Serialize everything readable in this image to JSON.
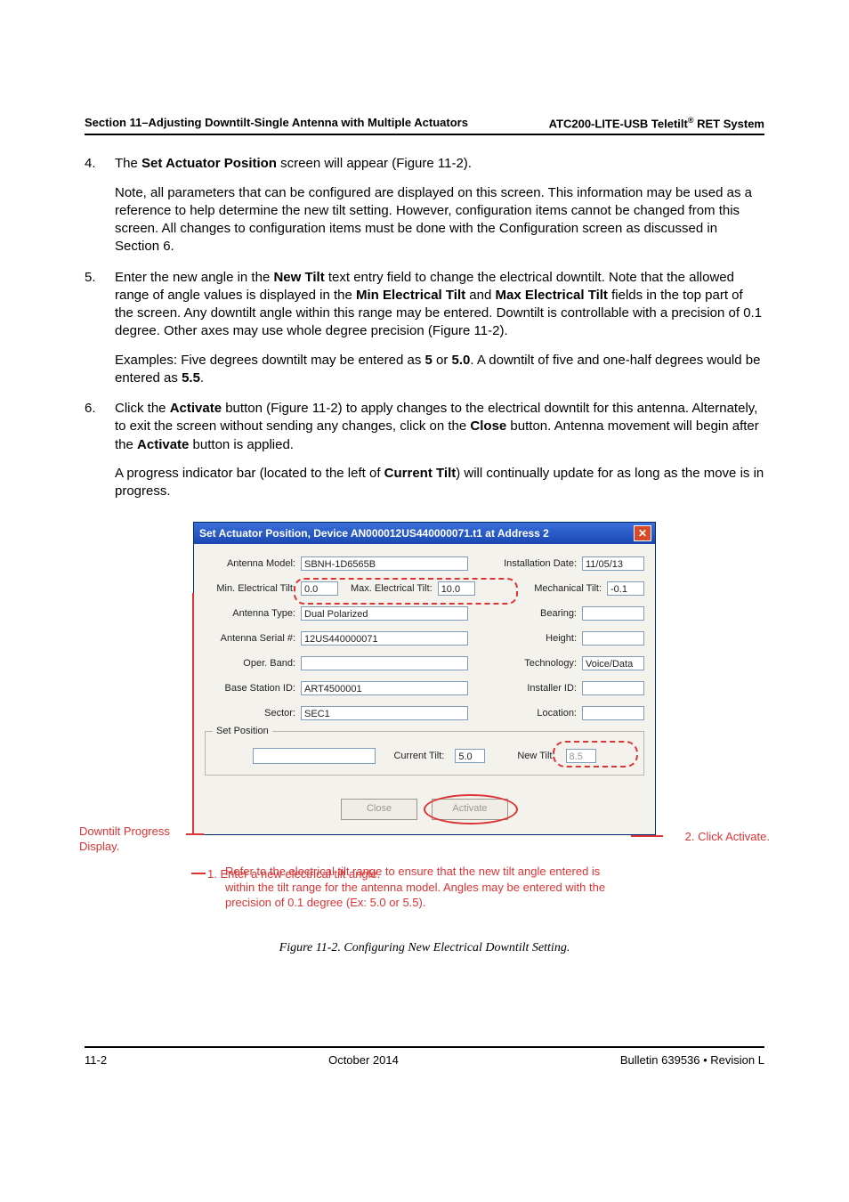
{
  "header": {
    "left": "Section 11–Adjusting Downtilt-Single Antenna with Multiple Actuators",
    "right_prefix": "ATC200-LITE-USB Teletilt",
    "right_sup": "®",
    "right_suffix": " RET System"
  },
  "list": {
    "item4_p1a": "The ",
    "item4_bold1": "Set Actuator Position",
    "item4_p1b": " screen will appear (Figure 11-2).",
    "item4_p2": "Note, all parameters that can be configured are displayed on this screen. This information may be used as a reference to help determine the new tilt setting. However, configuration items cannot be changed from this screen. All changes to configuration items must be done with the Configuration screen as discussed in Section 6.",
    "item5_p1a": "Enter the new angle in the ",
    "item5_bold1": "New Tilt",
    "item5_p1b": " text entry field to change the electrical downtilt. Note that the allowed range of angle values is displayed in the ",
    "item5_bold2": "Min Electrical Tilt",
    "item5_p1c": " and ",
    "item5_bold3": "Max Electrical Tilt",
    "item5_p1d": " fields in the top part of the screen. Any downtilt angle within this range may be entered. Downtilt is controllable with a precision of 0.1 degree. Other axes may use whole degree precision (Figure 11-2).",
    "item5_p2a": "Examples: Five degrees downtilt may be entered as ",
    "item5_bold4": "5",
    "item5_p2b": " or ",
    "item5_bold5": "5.0",
    "item5_p2c": ". A downtilt of five and one-half degrees would be entered as ",
    "item5_bold6": "5.5",
    "item5_p2d": ".",
    "item6_p1a": "Click the ",
    "item6_bold1": "Activate",
    "item6_p1b": " button (Figure 11-2) to apply changes to the electrical downtilt for this antenna. Alternately, to exit the screen without sending any changes, click on the ",
    "item6_bold2": "Close",
    "item6_p1c": " button. Antenna movement will begin after the ",
    "item6_bold3": "Activate",
    "item6_p1d": " button is applied.",
    "item6_p2a": "A progress indicator bar (located to the left of ",
    "item6_bold4": "Current Tilt",
    "item6_p2b": ") will continually update for as long as the move is in progress."
  },
  "dialog": {
    "title": "Set Actuator Position, Device AN000012US440000071.t1 at Address 2",
    "labels": {
      "antenna_model": "Antenna Model:",
      "install_date": "Installation Date:",
      "min_tilt": "Min. Electrical Tilt:",
      "max_tilt": "Max. Electrical Tilt:",
      "mech_tilt": "Mechanical Tilt:",
      "antenna_type": "Antenna Type:",
      "bearing": "Bearing:",
      "antenna_serial": "Antenna Serial #:",
      "height": "Height:",
      "oper_band": "Oper. Band:",
      "technology": "Technology:",
      "base_station": "Base Station ID:",
      "installer": "Installer ID:",
      "sector": "Sector:",
      "location": "Location:",
      "set_position": "Set Position",
      "current_tilt": "Current Tilt:",
      "new_tilt": "New Tilt:"
    },
    "values": {
      "antenna_model": "SBNH-1D6565B",
      "install_date": "11/05/13",
      "min_tilt": "0.0",
      "max_tilt": "10.0",
      "mech_tilt": "-0.1",
      "antenna_type": "Dual Polarized",
      "bearing": "",
      "antenna_serial": "12US440000071",
      "height": "",
      "oper_band": "",
      "technology": "Voice/Data",
      "base_station": "ART4500001",
      "installer": "",
      "sector": "SEC1",
      "location": "",
      "current_tilt": "5.0",
      "new_tilt": "8.5"
    },
    "buttons": {
      "close": "Close",
      "activate": "Activate"
    }
  },
  "callouts": {
    "progress": "Downtilt Progress Display.",
    "activate": "2. Click Activate.",
    "step1": "1.   Enter a new electrical tilt angle.",
    "note": "Refer to the electrical tilt range to ensure that the new tilt angle entered is within the tilt range for the antenna model.  Angles may be entered with the precision of 0.1 degree (Ex: 5.0 or 5.5)."
  },
  "figure_caption": "Figure 11-2. Configuring New Electrical Downtilt Setting.",
  "footer": {
    "left": "11-2",
    "center": "October 2014",
    "right": "Bulletin 639536  •  Revision L"
  }
}
